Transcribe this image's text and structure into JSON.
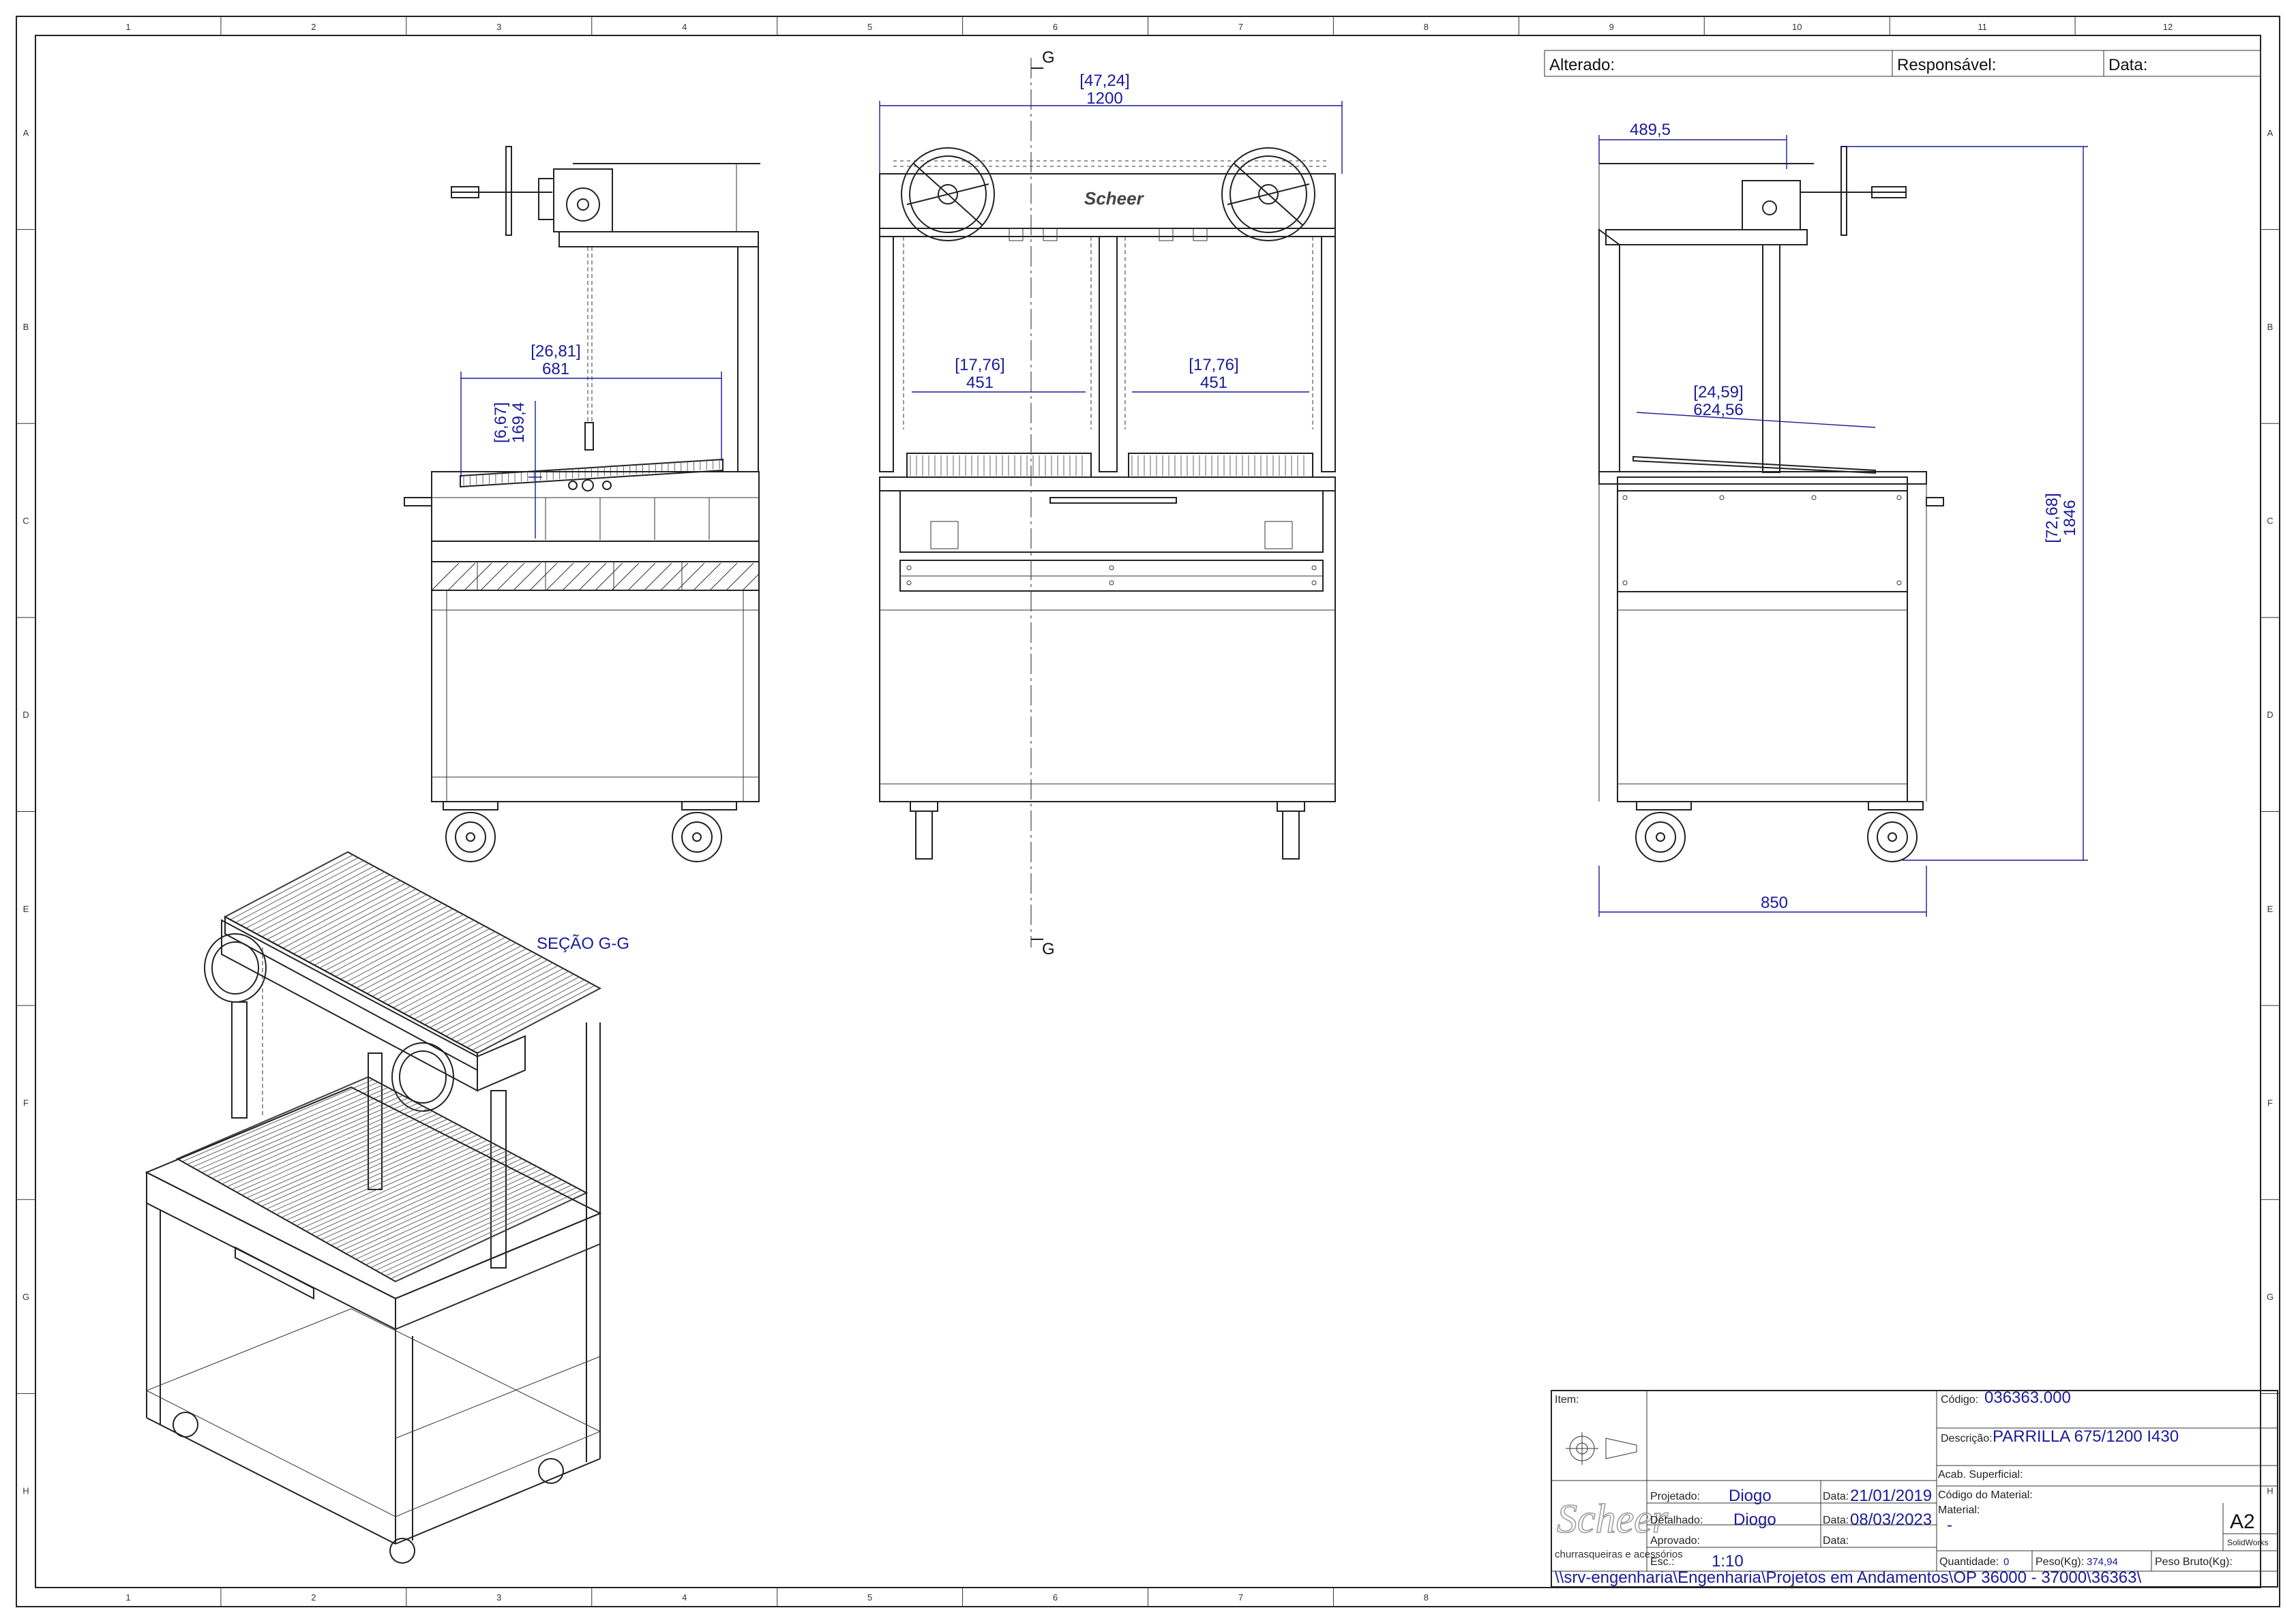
{
  "zones": {
    "columns": [
      "1",
      "2",
      "3",
      "4",
      "5",
      "6",
      "7",
      "8",
      "9",
      "10",
      "11",
      "12"
    ],
    "bottom_columns": [
      "1",
      "2",
      "3",
      "4",
      "5",
      "6",
      "7",
      "8"
    ],
    "rows": [
      "A",
      "B",
      "C",
      "D",
      "E",
      "F",
      "G",
      "H"
    ]
  },
  "revision": {
    "changed_label": "Alterado:",
    "responsible_label": "Responsável:",
    "date_label": "Data:"
  },
  "dimensions": {
    "side_width_in": "[26,81]",
    "side_width_mm": "681",
    "side_height_in": "[6,67]",
    "side_height_mm": "169,4",
    "front_total_in": "[47,24]",
    "front_total_mm": "1200",
    "front_left_in": "[17,76]",
    "front_left_mm": "451",
    "front_right_in": "[17,76]",
    "front_right_mm": "451",
    "right_top_mm": "489,5",
    "right_grill_in": "[24,59]",
    "right_grill_mm": "624,56",
    "right_height_in": "[72,68]",
    "right_height_mm": "1846",
    "right_depth_mm": "850"
  },
  "section": {
    "marker": "G",
    "label": "SEÇÃO G-G",
    "brand_plate": "Scheer"
  },
  "title_block": {
    "item_label": "Item:",
    "code_label": "Código:",
    "code_value": "036363.000",
    "description_label": "Descrição:",
    "description_value": "PARRILLA 675/1200 I430",
    "finish_label": "Acab. Superficial:",
    "material_code_label": "Código do Material:",
    "material_label": "Material:",
    "material_value": "-",
    "designed_label": "Projetado:",
    "designed_value": "Diogo",
    "designed_date_label": "Data:",
    "designed_date_value": "21/01/2019",
    "detailed_label": "Detalhado:",
    "detailed_value": "Diogo",
    "detailed_date_label": "Data:",
    "detailed_date_value": "08/03/2023",
    "approved_label": "Aprovado:",
    "approved_date_label": "Data:",
    "scale_label": "Esc.:",
    "scale_value": "1:10",
    "quantity_label": "Quantidade:",
    "quantity_value": "0",
    "weight_label": "Peso(Kg):",
    "weight_value": "374,94",
    "gross_weight_label": "Peso Bruto(Kg):",
    "sheet_size": "A2",
    "software": "SolidWorks",
    "company_logo": "Scheer",
    "company_tagline": "churrasqueiras e acessórios",
    "file_path": "\\\\srv-engenharia\\Engenharia\\Projetos em Andamentos\\OP 36000 - 37000\\36363\\"
  }
}
